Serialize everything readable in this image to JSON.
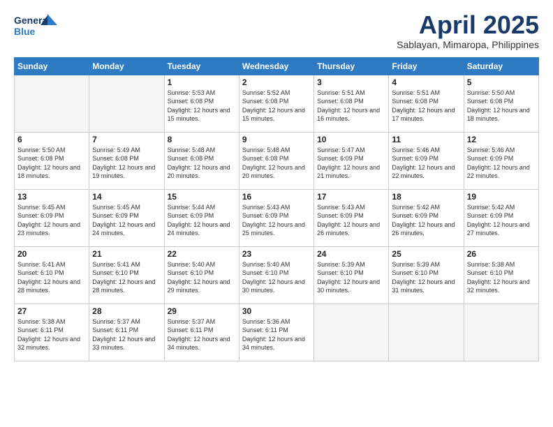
{
  "header": {
    "logo_general": "General",
    "logo_blue": "Blue",
    "month_title": "April 2025",
    "location": "Sablayan, Mimaropa, Philippines"
  },
  "weekdays": [
    "Sunday",
    "Monday",
    "Tuesday",
    "Wednesday",
    "Thursday",
    "Friday",
    "Saturday"
  ],
  "weeks": [
    [
      {
        "day": "",
        "info": ""
      },
      {
        "day": "",
        "info": ""
      },
      {
        "day": "1",
        "info": "Sunrise: 5:53 AM\nSunset: 6:08 PM\nDaylight: 12 hours and 15 minutes."
      },
      {
        "day": "2",
        "info": "Sunrise: 5:52 AM\nSunset: 6:08 PM\nDaylight: 12 hours and 15 minutes."
      },
      {
        "day": "3",
        "info": "Sunrise: 5:51 AM\nSunset: 6:08 PM\nDaylight: 12 hours and 16 minutes."
      },
      {
        "day": "4",
        "info": "Sunrise: 5:51 AM\nSunset: 6:08 PM\nDaylight: 12 hours and 17 minutes."
      },
      {
        "day": "5",
        "info": "Sunrise: 5:50 AM\nSunset: 6:08 PM\nDaylight: 12 hours and 18 minutes."
      }
    ],
    [
      {
        "day": "6",
        "info": "Sunrise: 5:50 AM\nSunset: 6:08 PM\nDaylight: 12 hours and 18 minutes."
      },
      {
        "day": "7",
        "info": "Sunrise: 5:49 AM\nSunset: 6:08 PM\nDaylight: 12 hours and 19 minutes."
      },
      {
        "day": "8",
        "info": "Sunrise: 5:48 AM\nSunset: 6:08 PM\nDaylight: 12 hours and 20 minutes."
      },
      {
        "day": "9",
        "info": "Sunrise: 5:48 AM\nSunset: 6:08 PM\nDaylight: 12 hours and 20 minutes."
      },
      {
        "day": "10",
        "info": "Sunrise: 5:47 AM\nSunset: 6:09 PM\nDaylight: 12 hours and 21 minutes."
      },
      {
        "day": "11",
        "info": "Sunrise: 5:46 AM\nSunset: 6:09 PM\nDaylight: 12 hours and 22 minutes."
      },
      {
        "day": "12",
        "info": "Sunrise: 5:46 AM\nSunset: 6:09 PM\nDaylight: 12 hours and 22 minutes."
      }
    ],
    [
      {
        "day": "13",
        "info": "Sunrise: 5:45 AM\nSunset: 6:09 PM\nDaylight: 12 hours and 23 minutes."
      },
      {
        "day": "14",
        "info": "Sunrise: 5:45 AM\nSunset: 6:09 PM\nDaylight: 12 hours and 24 minutes."
      },
      {
        "day": "15",
        "info": "Sunrise: 5:44 AM\nSunset: 6:09 PM\nDaylight: 12 hours and 24 minutes."
      },
      {
        "day": "16",
        "info": "Sunrise: 5:43 AM\nSunset: 6:09 PM\nDaylight: 12 hours and 25 minutes."
      },
      {
        "day": "17",
        "info": "Sunrise: 5:43 AM\nSunset: 6:09 PM\nDaylight: 12 hours and 26 minutes."
      },
      {
        "day": "18",
        "info": "Sunrise: 5:42 AM\nSunset: 6:09 PM\nDaylight: 12 hours and 26 minutes."
      },
      {
        "day": "19",
        "info": "Sunrise: 5:42 AM\nSunset: 6:09 PM\nDaylight: 12 hours and 27 minutes."
      }
    ],
    [
      {
        "day": "20",
        "info": "Sunrise: 5:41 AM\nSunset: 6:10 PM\nDaylight: 12 hours and 28 minutes."
      },
      {
        "day": "21",
        "info": "Sunrise: 5:41 AM\nSunset: 6:10 PM\nDaylight: 12 hours and 28 minutes."
      },
      {
        "day": "22",
        "info": "Sunrise: 5:40 AM\nSunset: 6:10 PM\nDaylight: 12 hours and 29 minutes."
      },
      {
        "day": "23",
        "info": "Sunrise: 5:40 AM\nSunset: 6:10 PM\nDaylight: 12 hours and 30 minutes."
      },
      {
        "day": "24",
        "info": "Sunrise: 5:39 AM\nSunset: 6:10 PM\nDaylight: 12 hours and 30 minutes."
      },
      {
        "day": "25",
        "info": "Sunrise: 5:39 AM\nSunset: 6:10 PM\nDaylight: 12 hours and 31 minutes."
      },
      {
        "day": "26",
        "info": "Sunrise: 5:38 AM\nSunset: 6:10 PM\nDaylight: 12 hours and 32 minutes."
      }
    ],
    [
      {
        "day": "27",
        "info": "Sunrise: 5:38 AM\nSunset: 6:11 PM\nDaylight: 12 hours and 32 minutes."
      },
      {
        "day": "28",
        "info": "Sunrise: 5:37 AM\nSunset: 6:11 PM\nDaylight: 12 hours and 33 minutes."
      },
      {
        "day": "29",
        "info": "Sunrise: 5:37 AM\nSunset: 6:11 PM\nDaylight: 12 hours and 34 minutes."
      },
      {
        "day": "30",
        "info": "Sunrise: 5:36 AM\nSunset: 6:11 PM\nDaylight: 12 hours and 34 minutes."
      },
      {
        "day": "",
        "info": ""
      },
      {
        "day": "",
        "info": ""
      },
      {
        "day": "",
        "info": ""
      }
    ]
  ]
}
